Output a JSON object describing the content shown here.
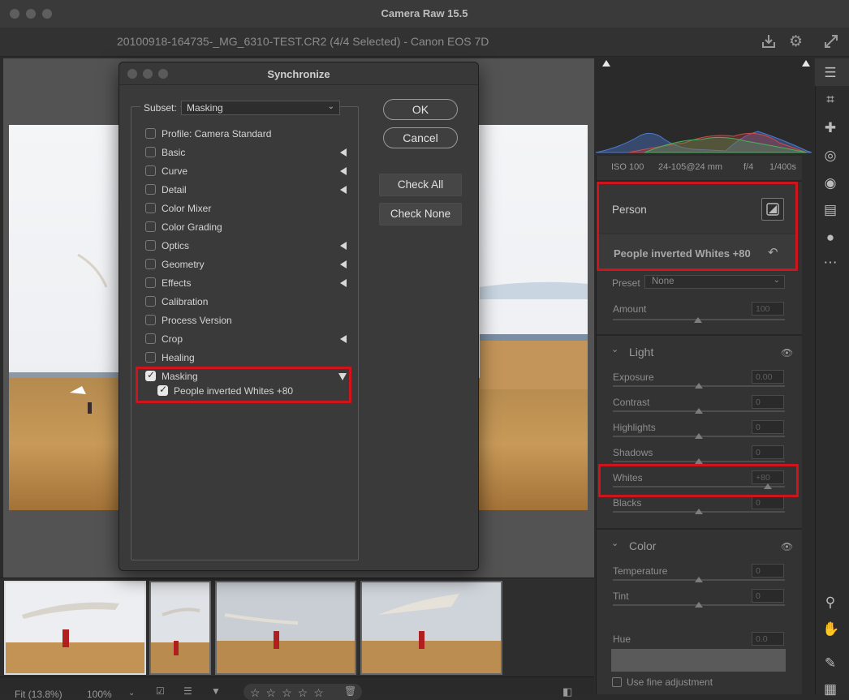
{
  "window": {
    "title": "Camera Raw 15.5"
  },
  "filebar": {
    "title": "20100918-164735-_MG_6310-TEST.CR2 (4/4 Selected)  -  Canon EOS 7D"
  },
  "histogram_meta": {
    "iso": "ISO 100",
    "lens": "24-105@24 mm",
    "aperture": "f/4",
    "shutter": "1/400s"
  },
  "mask_panel": {
    "mask_type": "Person",
    "mask_name": "People inverted Whites +80",
    "preset_label": "Preset",
    "preset_value": "None",
    "amount_label": "Amount",
    "amount_value": "100"
  },
  "light": {
    "title": "Light",
    "rows": [
      {
        "label": "Exposure",
        "value": "0.00",
        "pos": 0.5
      },
      {
        "label": "Contrast",
        "value": "0",
        "pos": 0.5
      },
      {
        "label": "Highlights",
        "value": "0",
        "pos": 0.5
      },
      {
        "label": "Shadows",
        "value": "0",
        "pos": 0.5
      },
      {
        "label": "Whites",
        "value": "+80",
        "pos": 0.9
      },
      {
        "label": "Blacks",
        "value": "0",
        "pos": 0.5
      }
    ]
  },
  "color": {
    "title": "Color",
    "rows": [
      {
        "label": "Temperature",
        "value": "0",
        "pos": 0.5
      },
      {
        "label": "Tint",
        "value": "0",
        "pos": 0.5
      }
    ],
    "hue_label": "Hue",
    "hue_value": "0.0",
    "fine_adjust_label": "Use fine adjustment"
  },
  "statusbar": {
    "fit": "Fit (13.8%)",
    "zoom": "100%"
  },
  "dialog": {
    "title": "Synchronize",
    "subset_label": "Subset:",
    "subset_value": "Masking",
    "ok": "OK",
    "cancel": "Cancel",
    "check_all": "Check All",
    "check_none": "Check None",
    "items": [
      {
        "label": "Profile: Camera Standard",
        "checked": false,
        "expand": false
      },
      {
        "label": "Basic",
        "checked": false,
        "expand": true
      },
      {
        "label": "Curve",
        "checked": false,
        "expand": true
      },
      {
        "label": "Detail",
        "checked": false,
        "expand": true
      },
      {
        "label": "Color Mixer",
        "checked": false,
        "expand": false
      },
      {
        "label": "Color Grading",
        "checked": false,
        "expand": false
      },
      {
        "label": "Optics",
        "checked": false,
        "expand": true
      },
      {
        "label": "Geometry",
        "checked": false,
        "expand": true
      },
      {
        "label": "Effects",
        "checked": false,
        "expand": true
      },
      {
        "label": "Calibration",
        "checked": false,
        "expand": false
      },
      {
        "label": "Process Version",
        "checked": false,
        "expand": false
      },
      {
        "label": "Crop",
        "checked": false,
        "expand": true
      },
      {
        "label": "Healing",
        "checked": false,
        "expand": false
      },
      {
        "label": "Masking",
        "checked": true,
        "expand": "down"
      }
    ],
    "sub_item": {
      "label": "People inverted Whites +80",
      "checked": true
    }
  },
  "colors": {
    "highlight_red": "#d0141b",
    "panel_bg": "#333333",
    "dialog_bg": "#3a3a3a"
  }
}
